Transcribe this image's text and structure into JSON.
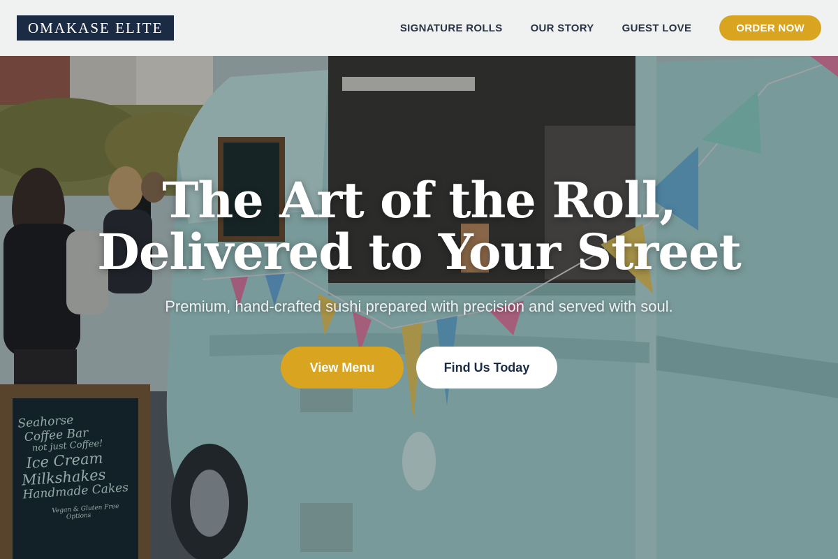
{
  "brand": {
    "name": "OMAKASE ELITE"
  },
  "nav": {
    "items": [
      {
        "label": "SIGNATURE ROLLS"
      },
      {
        "label": "OUR STORY"
      },
      {
        "label": "GUEST LOVE"
      }
    ],
    "order_button": "ORDER NOW"
  },
  "hero": {
    "title_line1": "The Art of the Roll,",
    "title_line2": "Delivered to Your Street",
    "subtitle": "Premium, hand-crafted sushi prepared with precision and served with soul.",
    "primary_cta": "View Menu",
    "secondary_cta": "Find Us Today",
    "image": {
      "chalkboard_lines": [
        "Seahorse",
        "Coffee Bar",
        "not just Coffee!",
        "Ice Cream",
        "Milkshakes",
        "Handmade Cakes",
        "Vegan & Gluten Free",
        "Options"
      ]
    }
  },
  "colors": {
    "accent": "#d9a521",
    "brand_navy": "#1c2b44",
    "header_bg": "#f5f5f5",
    "truck": "#a9d4d0"
  }
}
